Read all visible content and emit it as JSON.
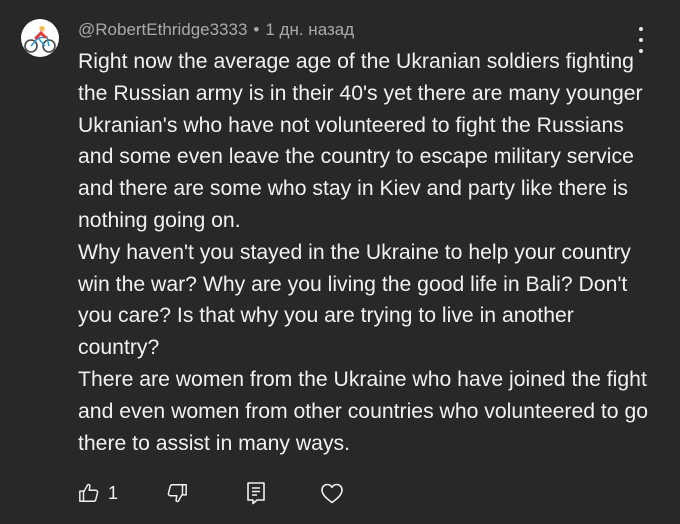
{
  "comment": {
    "author": "@RobertEthridge3333",
    "separator": "•",
    "timestamp": "1 дн. назад",
    "paragraphs": [
      "Right now the average age of the Ukranian soldiers fighting the Russian army is in their 40's yet there are many younger Ukranian's who have not volunteered to fight the Russians and some even leave the country to escape military service and there are some who stay in Kiev and party like there is nothing going on.",
      "Why haven't you stayed in the Ukraine to help your country win the war? Why are you living the good life in Bali? Don't you care? Is that why you are trying to live in another country?",
      "There are women from the Ukraine who have joined the fight and even women from other countries who volunteered to go there to assist in many ways."
    ]
  },
  "actions": {
    "like_count": "1"
  },
  "icons": {
    "avatar": "cyclist-emoji-avatar",
    "more": "more-vertical-icon",
    "like": "thumbs-up-icon",
    "dislike": "thumbs-down-icon",
    "reply": "reply-comment-icon",
    "heart": "heart-icon"
  },
  "colors": {
    "background": "#282828",
    "text": "#f1f1f1",
    "meta": "#aaaaaa"
  }
}
